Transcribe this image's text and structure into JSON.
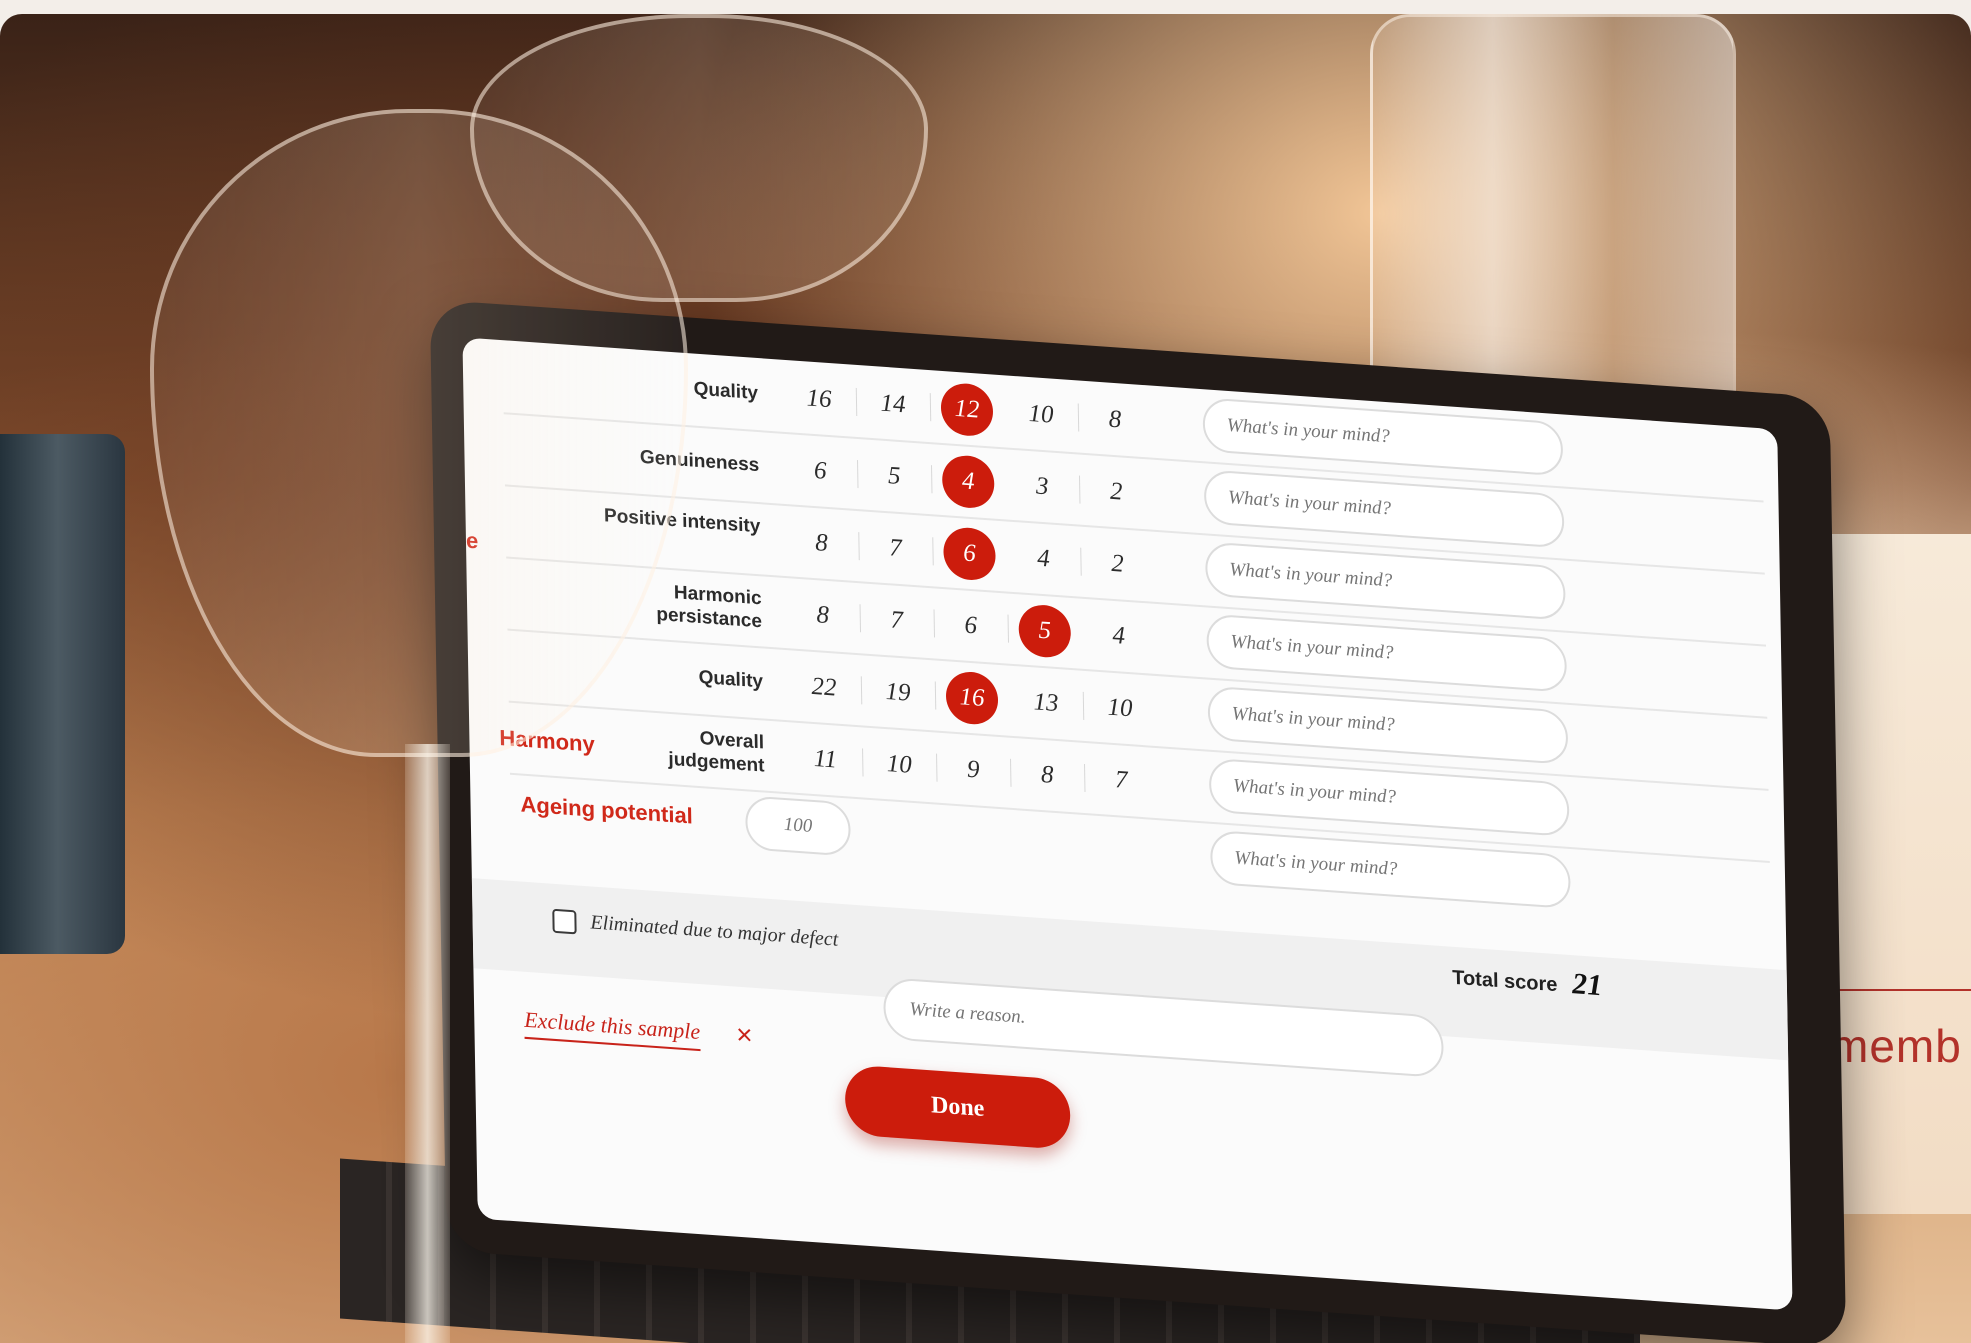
{
  "background": {
    "member_text": "memb"
  },
  "rows": [
    {
      "label": "Quality",
      "scores": [
        "16",
        "14",
        "12",
        "10",
        "8"
      ],
      "selected": "12",
      "placeholder": "What's in your mind?"
    },
    {
      "label": "Genuineness",
      "scores": [
        "6",
        "5",
        "4",
        "3",
        "2"
      ],
      "selected": "4",
      "placeholder": "What's in your mind?"
    },
    {
      "label": "Positive intensity",
      "scores": [
        "8",
        "7",
        "6",
        "4",
        "2"
      ],
      "selected": "6",
      "placeholder": "What's in your mind?"
    },
    {
      "label": "Harmonic persistance",
      "scores": [
        "8",
        "7",
        "6",
        "5",
        "4"
      ],
      "selected": "5",
      "placeholder": "What's in your mind?"
    },
    {
      "label": "Quality",
      "scores": [
        "22",
        "19",
        "16",
        "13",
        "10"
      ],
      "selected": "16",
      "placeholder": "What's in your mind?"
    },
    {
      "label": "Overall judgement",
      "scores": [
        "11",
        "10",
        "9",
        "8",
        "7"
      ],
      "selected": null,
      "placeholder": "What's in your mind?"
    }
  ],
  "groups": {
    "partial_label": "e",
    "harmony": "Harmony",
    "ageing": "Ageing potential"
  },
  "ageing": {
    "placeholder": "100",
    "note_placeholder": "What's in your mind?"
  },
  "footer": {
    "eliminated_label": "Eliminated due to major defect",
    "total_label": "Total score",
    "total_value": "21",
    "reason_placeholder": "Write a reason.",
    "exclude_label": "Exclude this sample",
    "exclude_icon": "×",
    "done_label": "Done"
  },
  "colors": {
    "accent": "#cc1c0c"
  }
}
